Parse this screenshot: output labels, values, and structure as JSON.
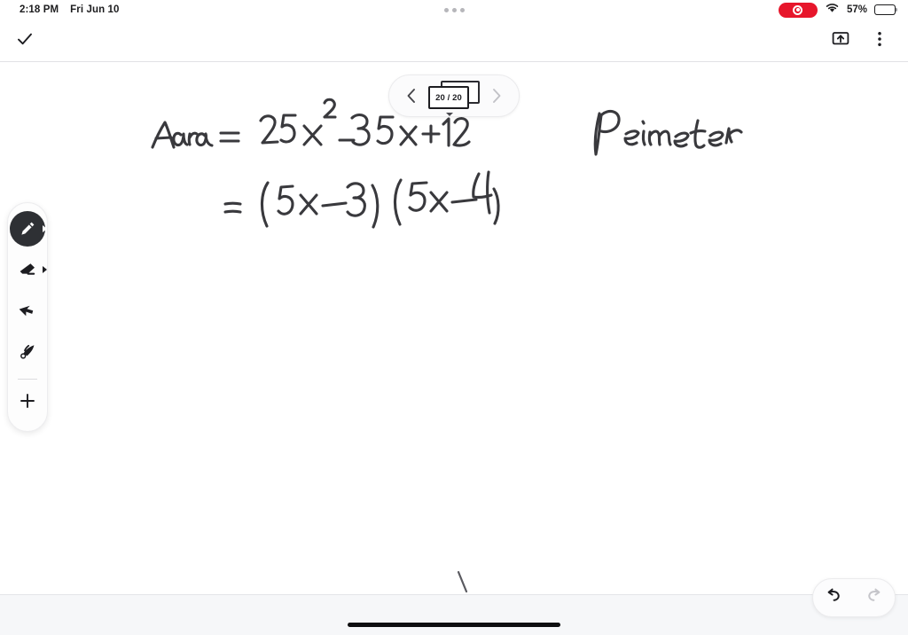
{
  "status_bar": {
    "time": "2:18 PM",
    "date": "Fri Jun 10",
    "battery_percent": "57%",
    "recording_icon": "record-indicator",
    "wifi_icon": "wifi-icon",
    "battery_icon": "battery-icon",
    "multitask_icon": "multitasking-dots"
  },
  "toolbar": {
    "done_icon": "checkmark-icon",
    "present_icon": "present-screen-icon",
    "more_icon": "more-vertical-icon"
  },
  "page_nav": {
    "prev_icon": "chevron-left-icon",
    "next_icon": "chevron-right-icon",
    "page_label": "20 / 20",
    "current_page": 20,
    "total_pages": 20,
    "dropdown_icon": "caret-down-icon"
  },
  "tool_palette": {
    "tools": [
      {
        "name": "pen-tool",
        "icon": "pen-icon",
        "active": true,
        "has_expander": true
      },
      {
        "name": "eraser-tool",
        "icon": "eraser-icon",
        "active": false,
        "has_expander": true
      },
      {
        "name": "select-tool",
        "icon": "arrow-select-icon",
        "active": false,
        "has_expander": false
      },
      {
        "name": "laser-tool",
        "icon": "laser-pointer-icon",
        "active": false,
        "has_expander": false
      }
    ],
    "add_label": "+",
    "add_icon": "plus-icon"
  },
  "history": {
    "undo_icon": "undo-arrow-icon",
    "undo_enabled": true,
    "redo_icon": "redo-arrow-icon",
    "redo_enabled": false
  },
  "canvas": {
    "ink_notes": [
      {
        "name": "area-equation-line-1",
        "text": "Area = 25x² − 35x + 12"
      },
      {
        "name": "area-equation-line-2",
        "text": "= (5x − 3)(5x − 4)"
      },
      {
        "name": "perimeter-heading",
        "text": "Perimeter"
      },
      {
        "name": "stray-stroke",
        "text": "\\"
      }
    ]
  },
  "colors": {
    "accent_record": "#e7162b",
    "ink": "#39393d",
    "tool_active_bg": "#2e3034",
    "canvas_bg": "#ffffff",
    "bottom_strip_bg": "#f6f7f9"
  }
}
